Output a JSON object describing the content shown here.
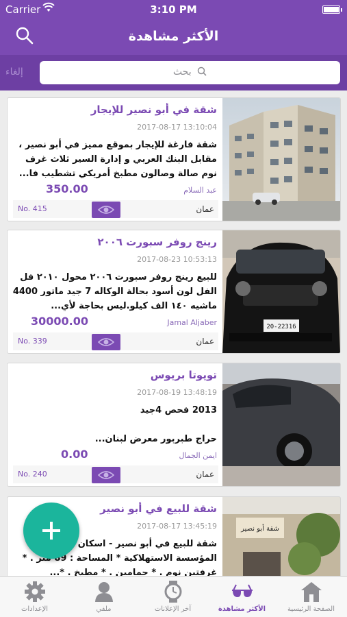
{
  "status": {
    "carrier": "Carrier",
    "time": "3:10 PM"
  },
  "nav": {
    "title": "الأكثر مشاهدة"
  },
  "search": {
    "cancel": "إلغاء",
    "placeholder": "بحث"
  },
  "listings": [
    {
      "title": "شقة في أبو نصير للإيجار",
      "date": "2017-08-17 13:10:04",
      "description": "شقة فارغة للإيجار بموقع مميز في أبو نصير ، مقابل البنك العربي و إدارة السير ثلاث غرف نوم صالة وصالون مطبخ أمريكي تشطيب فا...",
      "price": "350.00",
      "author": "عبد السلام",
      "number": "No. 415",
      "city": "عمان"
    },
    {
      "title": "رينج روفر سبورت ٢٠٠٦",
      "date": "2017-08-23 10:53:13",
      "description": "للبيع رينج روفر سبورت ٢٠٠٦ محول ٢٠١٠ فل الفل لون أسود بحالة الوكاله 7 جيد ماتور 4400 ماشيه ١٤٠ الف كيلو.ليس بحاجة لأي...",
      "price": "30000.00",
      "author": "Jamal Aljaber",
      "number": "No. 339",
      "city": "عمان"
    },
    {
      "title": "تويوتا بريوس",
      "date": "2017-08-19 13:48:19",
      "description": "2013 فحص 4جيد\n\nحراج طبربور معرض لبنان...",
      "price": "0.00",
      "author": "ايمن الجمال",
      "number": "No. 240",
      "city": "عمان"
    },
    {
      "title": "شقة للبيع في أبو نصير",
      "date": "2017-08-17 13:45:19",
      "description": "شقة للبيع في أبو نصير - اسكان خلف المؤسسة الاستهلاكية * المساحة : 89 متر . * غرفتين نوم . * حمامين . * مطبخ . *...",
      "price": "",
      "author": "",
      "number": "",
      "city": ""
    }
  ],
  "tabs": [
    {
      "label": "الإعدادات",
      "icon": "gear-icon"
    },
    {
      "label": "ملفي",
      "icon": "person-icon"
    },
    {
      "label": "آخر الإعلانات",
      "icon": "watch-icon"
    },
    {
      "label": "الأكثر مشاهدة",
      "icon": "glasses-icon",
      "active": true
    },
    {
      "label": "الصفحة الرئيسية",
      "icon": "home-icon"
    }
  ],
  "colors": {
    "brand": "#7b4ab3",
    "fab": "#1bb59c"
  }
}
